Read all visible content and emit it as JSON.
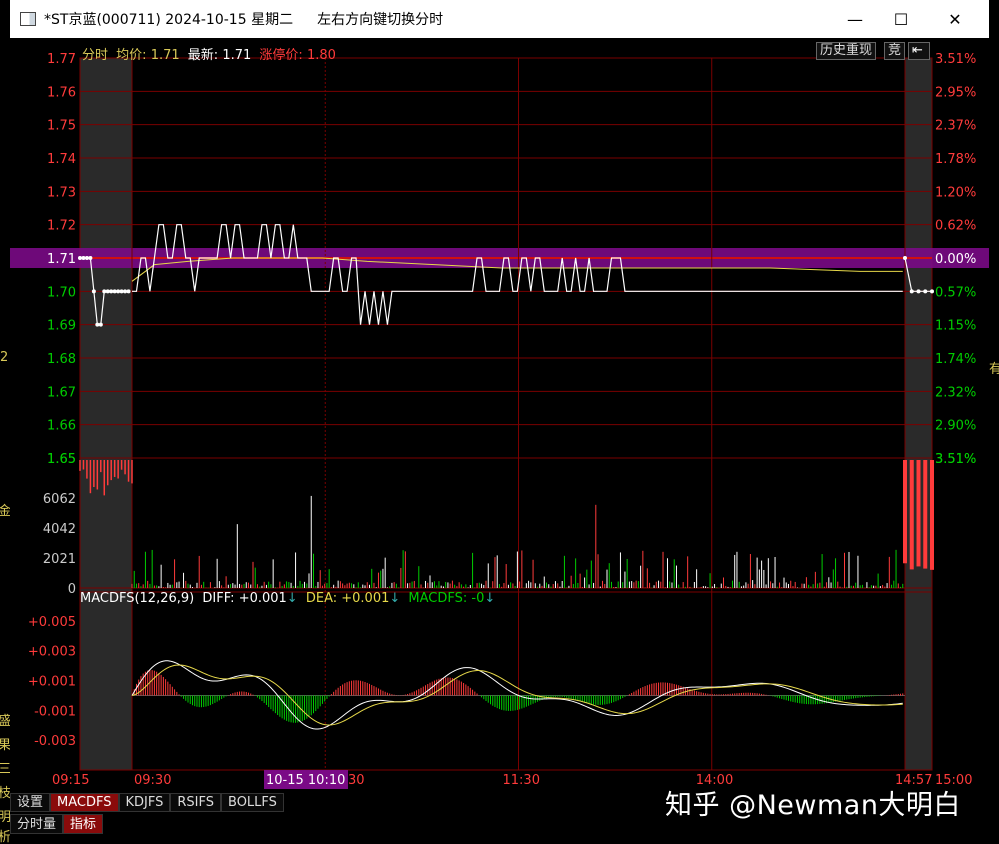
{
  "window": {
    "title": "*ST京蓝(000711) 2024-10-15 星期二",
    "hint": "左右方向键切换分时",
    "minimize": "—",
    "maximize": "☐",
    "close": "✕"
  },
  "info_bar": {
    "mode": "分时",
    "avg_label": "均价:",
    "avg_value": "1.71",
    "latest_label": "最新:",
    "latest_value": "1.71",
    "limit_label": "涨停价:",
    "limit_value": "1.80",
    "history_button": "历史重现",
    "bid_button": "竞"
  },
  "colors": {
    "up": "#ff3b3b",
    "down": "#00cc00",
    "flat": "#ffffff",
    "avg_line": "#e6d84a",
    "grid": "#7a0000",
    "highlight": "#7a0a86"
  },
  "price_axis": {
    "left": [
      "1.77",
      "1.76",
      "1.75",
      "1.74",
      "1.73",
      "1.72",
      "1.71",
      "1.70",
      "1.69",
      "1.68",
      "1.67",
      "1.66",
      "1.65"
    ],
    "right": [
      "3.51%",
      "2.95%",
      "2.37%",
      "1.78%",
      "1.20%",
      "0.62%",
      "0.00%",
      "0.57%",
      "1.15%",
      "1.74%",
      "2.32%",
      "2.90%",
      "3.51%"
    ]
  },
  "volume_axis": [
    "6062",
    "4042",
    "2021",
    "0"
  ],
  "macd": {
    "header_name": "MACDFS(12,26,9)",
    "diff_label": "DIFF:",
    "diff_value": "+0.001",
    "dea_label": "DEA:",
    "dea_value": "+0.001",
    "macdfs_label": "MACDFS:",
    "macdfs_value": "-0",
    "axis": [
      "+0.005",
      "+0.003",
      "+0.001",
      "-0.001",
      "-0.003"
    ]
  },
  "time_axis": {
    "labels": [
      "09:15",
      "09:30",
      "11:30",
      "14:00",
      "14:57",
      "15:00"
    ],
    "cursor_label": "10-15 10:10",
    "cursor_suffix": "30"
  },
  "tabs": [
    "设置",
    "MACDFS",
    "KDJFS",
    "RSIFS",
    "BOLLFS"
  ],
  "tabs_active": "MACDFS",
  "sub_tabs": [
    "分时量",
    "指标"
  ],
  "sub_tabs_active": "指标",
  "watermark": "知乎 @Newman大明白",
  "side_fragments": {
    "left": [
      "2",
      "金",
      "盛",
      "果",
      "三",
      "枝",
      "明",
      "析"
    ],
    "right": [
      "有"
    ]
  },
  "chart_data": {
    "type": "line",
    "title": "",
    "session_minutes": [
      "09:15",
      "09:30",
      "11:30",
      "14:00",
      "14:57",
      "15:00"
    ],
    "preclose": 1.71,
    "price_ylim": [
      1.65,
      1.77
    ],
    "price_series": [
      {
        "name": "价格",
        "segment": "auction",
        "x": [
          0,
          1,
          2,
          3,
          4,
          5,
          6,
          7,
          8,
          9,
          10,
          11,
          12,
          13,
          14
        ],
        "y": [
          1.71,
          1.71,
          1.71,
          1.71,
          1.7,
          1.69,
          1.69,
          1.7,
          1.7,
          1.7,
          1.7,
          1.7,
          1.7,
          1.7,
          1.7
        ]
      },
      {
        "name": "价格",
        "segment": "continuous",
        "x": [
          15,
          17,
          19,
          21,
          23,
          25,
          27,
          29,
          31,
          33,
          35,
          37,
          39,
          41,
          43,
          45,
          47,
          49,
          51,
          53,
          55,
          57,
          59,
          61,
          63,
          65,
          67,
          69,
          71,
          73,
          75,
          77,
          79,
          81,
          83,
          85,
          87,
          89,
          91,
          93,
          95,
          97,
          99,
          101,
          103,
          105,
          107,
          109,
          111,
          113,
          115,
          117,
          119,
          121,
          123,
          125,
          127,
          129,
          131,
          133,
          135,
          137,
          139,
          141,
          143,
          145,
          147,
          149,
          151,
          153,
          155,
          157,
          159,
          161,
          163,
          165,
          167,
          169,
          171,
          173,
          175,
          177,
          179,
          181,
          183,
          185,
          187,
          189,
          191,
          193,
          195,
          197,
          199,
          201,
          203,
          205,
          207,
          209,
          211,
          213,
          215,
          217,
          219,
          221,
          223,
          225,
          227,
          229,
          231,
          233,
          235,
          237,
          239,
          241,
          243,
          245,
          247,
          249,
          251,
          253,
          255,
          257,
          259,
          261,
          263,
          265,
          267,
          269,
          271,
          273,
          275,
          277,
          279,
          281,
          283,
          285,
          287,
          289,
          291,
          293,
          295,
          297,
          299,
          301,
          303,
          305,
          307,
          309,
          311,
          313,
          315,
          317,
          319,
          321,
          323,
          325,
          327,
          329,
          331,
          333,
          335,
          337,
          339,
          341,
          343,
          345,
          347,
          349,
          351,
          353,
          355,
          357,
          359
        ],
        "y": [
          1.7,
          1.7,
          1.71,
          1.71,
          1.7,
          1.71,
          1.72,
          1.72,
          1.71,
          1.71,
          1.72,
          1.72,
          1.71,
          1.71,
          1.7,
          1.71,
          1.71,
          1.71,
          1.71,
          1.71,
          1.72,
          1.72,
          1.71,
          1.72,
          1.72,
          1.71,
          1.71,
          1.71,
          1.71,
          1.72,
          1.72,
          1.71,
          1.72,
          1.72,
          1.71,
          1.71,
          1.72,
          1.71,
          1.71,
          1.71,
          1.7,
          1.7,
          1.7,
          1.7,
          1.7,
          1.71,
          1.71,
          1.7,
          1.7,
          1.71,
          1.71,
          1.69,
          1.7,
          1.69,
          1.7,
          1.69,
          1.7,
          1.69,
          1.7,
          1.7,
          1.7,
          1.7,
          1.7,
          1.7,
          1.7,
          1.7,
          1.7,
          1.7,
          1.7,
          1.7,
          1.7,
          1.7,
          1.7,
          1.7,
          1.7,
          1.7,
          1.7,
          1.71,
          1.71,
          1.7,
          1.7,
          1.7,
          1.7,
          1.71,
          1.71,
          1.7,
          1.7,
          1.71,
          1.71,
          1.7,
          1.71,
          1.71,
          1.7,
          1.7,
          1.7,
          1.7,
          1.71,
          1.7,
          1.7,
          1.71,
          1.7,
          1.7,
          1.71,
          1.7,
          1.7,
          1.7,
          1.7,
          1.71,
          1.71,
          1.71,
          1.7,
          1.7,
          1.7,
          1.7,
          1.7,
          1.7,
          1.7,
          1.7,
          1.7,
          1.7,
          1.7,
          1.7,
          1.7,
          1.7,
          1.7,
          1.7,
          1.7,
          1.7,
          1.7,
          1.7,
          1.7,
          1.7,
          1.7,
          1.7,
          1.7,
          1.7,
          1.7,
          1.7,
          1.7,
          1.7,
          1.7,
          1.7,
          1.7,
          1.7,
          1.7,
          1.7,
          1.7,
          1.7,
          1.7,
          1.7,
          1.7,
          1.7,
          1.7,
          1.7,
          1.7,
          1.7,
          1.7,
          1.7,
          1.7,
          1.7,
          1.7,
          1.7,
          1.7,
          1.7,
          1.7,
          1.7,
          1.7,
          1.7,
          1.7,
          1.7,
          1.7,
          1.7,
          1.7,
          1.71,
          1.7,
          1.7,
          1.7,
          1.7
        ]
      },
      {
        "name": "价格",
        "segment": "closing",
        "x": [
          360,
          361,
          362,
          363,
          364
        ],
        "y": [
          1.71,
          1.7,
          1.7,
          1.7,
          1.7
        ]
      }
    ],
    "avg_series": {
      "name": "均价",
      "x": [
        15,
        25,
        40,
        60,
        80,
        100,
        120,
        150,
        180,
        220,
        260,
        300,
        340,
        359
      ],
      "y": [
        1.703,
        1.708,
        1.709,
        1.71,
        1.71,
        1.71,
        1.709,
        1.708,
        1.707,
        1.707,
        1.707,
        1.707,
        1.706,
        1.706
      ]
    },
    "volume_ylim": [
      0,
      8080
    ],
    "macd_ylim": [
      -0.005,
      0.006
    ]
  }
}
